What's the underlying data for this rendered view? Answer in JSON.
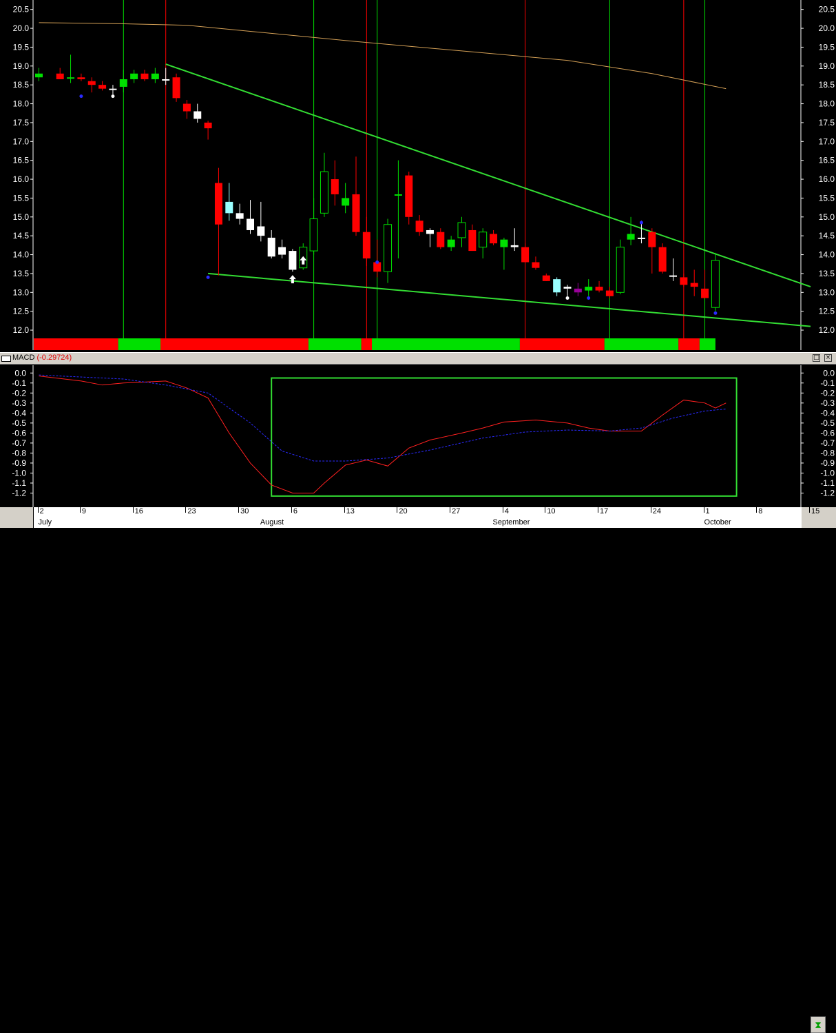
{
  "colors": {
    "bull": "#00e000",
    "bear": "#ff0000",
    "neutral": "#ffffff",
    "cyan": "#99ffff",
    "purple": "#990099",
    "trendline": "#33dd33",
    "ma200": "#d4a056",
    "macd": "#ff2020",
    "signal": "#2a2aff",
    "axis_text": "#ffffff"
  },
  "chart_data": [
    {
      "type": "candlestick",
      "ylim": [
        11.8,
        20.75
      ],
      "yticks": [
        "20.5",
        "20.0",
        "19.5",
        "19.0",
        "18.5",
        "18.0",
        "17.5",
        "17.0",
        "16.5",
        "16.0",
        "15.5",
        "15.0",
        "14.5",
        "14.0",
        "13.5",
        "13.0",
        "12.5",
        "12.0"
      ],
      "x_range": [
        0,
        98
      ],
      "candles": [
        {
          "x": 0,
          "o": 18.7,
          "h": 18.95,
          "l": 18.6,
          "c": 18.8,
          "col": "bull"
        },
        {
          "x": 2,
          "o": 18.8,
          "h": 18.95,
          "l": 18.65,
          "c": 18.65,
          "col": "bear"
        },
        {
          "x": 3,
          "o": 18.7,
          "h": 19.3,
          "l": 18.55,
          "c": 18.7,
          "col": "bull"
        },
        {
          "x": 4,
          "o": 18.7,
          "h": 18.8,
          "l": 18.6,
          "c": 18.65,
          "col": "bear"
        },
        {
          "x": 5,
          "o": 18.6,
          "h": 18.7,
          "l": 18.3,
          "c": 18.5,
          "col": "bear"
        },
        {
          "x": 6,
          "o": 18.5,
          "h": 18.6,
          "l": 18.35,
          "c": 18.4,
          "col": "bear"
        },
        {
          "x": 7,
          "o": 18.4,
          "h": 18.5,
          "l": 18.25,
          "c": 18.4,
          "col": "neutral"
        },
        {
          "x": 8,
          "o": 18.45,
          "h": 18.9,
          "l": 18.3,
          "c": 18.65,
          "col": "bull"
        },
        {
          "x": 9,
          "o": 18.65,
          "h": 18.9,
          "l": 18.55,
          "c": 18.8,
          "col": "bull"
        },
        {
          "x": 10,
          "o": 18.8,
          "h": 18.9,
          "l": 18.6,
          "c": 18.65,
          "col": "bear"
        },
        {
          "x": 11,
          "o": 18.65,
          "h": 18.95,
          "l": 18.55,
          "c": 18.8,
          "col": "bull"
        },
        {
          "x": 12,
          "o": 18.65,
          "h": 18.95,
          "l": 18.5,
          "c": 18.65,
          "col": "neutral"
        },
        {
          "x": 13,
          "o": 18.7,
          "h": 18.8,
          "l": 18.05,
          "c": 18.15,
          "col": "bear"
        },
        {
          "x": 14,
          "o": 18.0,
          "h": 18.1,
          "l": 17.6,
          "c": 17.8,
          "col": "bear"
        },
        {
          "x": 15,
          "o": 17.8,
          "h": 18.0,
          "l": 17.5,
          "c": 17.6,
          "col": "neutral"
        },
        {
          "x": 16,
          "o": 17.5,
          "h": 17.55,
          "l": 17.05,
          "c": 17.35,
          "col": "bear"
        },
        {
          "x": 17,
          "o": 15.9,
          "h": 16.3,
          "l": 13.45,
          "c": 14.8,
          "col": "bear"
        },
        {
          "x": 18,
          "o": 15.1,
          "h": 15.9,
          "l": 14.9,
          "c": 15.4,
          "col": "cyan"
        },
        {
          "x": 19,
          "o": 15.1,
          "h": 15.35,
          "l": 14.8,
          "c": 14.95,
          "col": "neutral"
        },
        {
          "x": 20,
          "o": 14.95,
          "h": 15.45,
          "l": 14.55,
          "c": 14.65,
          "col": "neutral"
        },
        {
          "x": 21,
          "o": 14.75,
          "h": 15.4,
          "l": 14.35,
          "c": 14.5,
          "col": "neutral"
        },
        {
          "x": 22,
          "o": 14.45,
          "h": 14.65,
          "l": 13.9,
          "c": 13.95,
          "col": "neutral"
        },
        {
          "x": 23,
          "o": 14.2,
          "h": 14.4,
          "l": 13.9,
          "c": 14.0,
          "col": "neutral"
        },
        {
          "x": 24,
          "o": 14.1,
          "h": 14.15,
          "l": 13.55,
          "c": 13.6,
          "col": "neutral"
        },
        {
          "x": 25,
          "o": 13.65,
          "h": 14.3,
          "l": 13.6,
          "c": 14.2,
          "col": "bull"
        },
        {
          "x": 26,
          "o": 14.1,
          "h": 15.5,
          "l": 14.0,
          "c": 14.95,
          "col": "bull"
        },
        {
          "x": 27,
          "o": 15.1,
          "h": 16.7,
          "l": 15.0,
          "c": 16.2,
          "col": "bull"
        },
        {
          "x": 28,
          "o": 16.0,
          "h": 16.5,
          "l": 15.3,
          "c": 15.6,
          "col": "bear"
        },
        {
          "x": 29,
          "o": 15.5,
          "h": 15.9,
          "l": 15.1,
          "c": 15.3,
          "col": "bull"
        },
        {
          "x": 30,
          "o": 15.6,
          "h": 16.6,
          "l": 14.5,
          "c": 14.6,
          "col": "bear"
        },
        {
          "x": 31,
          "o": 14.6,
          "h": 15.0,
          "l": 13.7,
          "c": 13.9,
          "col": "bear"
        },
        {
          "x": 32,
          "o": 13.8,
          "h": 14.4,
          "l": 13.4,
          "c": 13.55,
          "col": "bear"
        },
        {
          "x": 33,
          "o": 13.55,
          "h": 14.95,
          "l": 13.25,
          "c": 14.8,
          "col": "bull"
        },
        {
          "x": 34,
          "o": 15.6,
          "h": 16.5,
          "l": 13.9,
          "c": 15.6,
          "col": "bull"
        },
        {
          "x": 35,
          "o": 16.1,
          "h": 16.2,
          "l": 14.8,
          "c": 15.0,
          "col": "bear"
        },
        {
          "x": 36,
          "o": 14.9,
          "h": 15.05,
          "l": 14.5,
          "c": 14.6,
          "col": "bear"
        },
        {
          "x": 37,
          "o": 14.65,
          "h": 14.7,
          "l": 14.2,
          "c": 14.55,
          "col": "neutral"
        },
        {
          "x": 38,
          "o": 14.6,
          "h": 14.7,
          "l": 14.15,
          "c": 14.2,
          "col": "bear"
        },
        {
          "x": 39,
          "o": 14.2,
          "h": 14.5,
          "l": 14.1,
          "c": 14.4,
          "col": "bull"
        },
        {
          "x": 40,
          "o": 14.45,
          "h": 15.0,
          "l": 14.2,
          "c": 14.85,
          "col": "bull"
        },
        {
          "x": 41,
          "o": 14.65,
          "h": 14.8,
          "l": 14.1,
          "c": 14.1,
          "col": "bear"
        },
        {
          "x": 42,
          "o": 14.2,
          "h": 14.7,
          "l": 13.9,
          "c": 14.6,
          "col": "bull"
        },
        {
          "x": 43,
          "o": 14.55,
          "h": 14.65,
          "l": 14.25,
          "c": 14.3,
          "col": "bear"
        },
        {
          "x": 44,
          "o": 14.4,
          "h": 14.45,
          "l": 13.6,
          "c": 14.2,
          "col": "bull"
        },
        {
          "x": 45,
          "o": 14.2,
          "h": 14.7,
          "l": 14.1,
          "c": 14.25,
          "col": "neutral"
        },
        {
          "x": 46,
          "o": 14.2,
          "h": 14.3,
          "l": 13.8,
          "c": 13.8,
          "col": "bear"
        },
        {
          "x": 47,
          "o": 13.8,
          "h": 13.95,
          "l": 13.6,
          "c": 13.65,
          "col": "bear"
        },
        {
          "x": 48,
          "o": 13.45,
          "h": 13.5,
          "l": 13.3,
          "c": 13.3,
          "col": "bear"
        },
        {
          "x": 49,
          "o": 13.0,
          "h": 13.4,
          "l": 12.9,
          "c": 13.35,
          "col": "cyan"
        },
        {
          "x": 50,
          "o": 13.15,
          "h": 13.2,
          "l": 12.9,
          "c": 13.1,
          "col": "neutral"
        },
        {
          "x": 51,
          "o": 13.1,
          "h": 13.25,
          "l": 12.9,
          "c": 13.0,
          "col": "purple"
        },
        {
          "x": 52,
          "o": 13.05,
          "h": 13.35,
          "l": 12.9,
          "c": 13.15,
          "col": "bull"
        },
        {
          "x": 53,
          "o": 13.15,
          "h": 13.3,
          "l": 13.0,
          "c": 13.05,
          "col": "bear"
        },
        {
          "x": 54,
          "o": 13.05,
          "h": 13.15,
          "l": 12.85,
          "c": 12.9,
          "col": "bear"
        },
        {
          "x": 55,
          "o": 13.0,
          "h": 14.4,
          "l": 12.95,
          "c": 14.2,
          "col": "bull"
        },
        {
          "x": 56,
          "o": 14.4,
          "h": 15.0,
          "l": 14.25,
          "c": 14.55,
          "col": "bull"
        },
        {
          "x": 57,
          "o": 14.45,
          "h": 14.9,
          "l": 14.3,
          "c": 14.45,
          "col": "neutral"
        },
        {
          "x": 58,
          "o": 14.6,
          "h": 14.7,
          "l": 13.5,
          "c": 14.2,
          "col": "bear"
        },
        {
          "x": 59,
          "o": 14.2,
          "h": 14.3,
          "l": 13.5,
          "c": 13.55,
          "col": "bear"
        },
        {
          "x": 60,
          "o": 13.45,
          "h": 13.9,
          "l": 13.3,
          "c": 13.45,
          "col": "neutral"
        },
        {
          "x": 61,
          "o": 13.4,
          "h": 13.5,
          "l": 13.15,
          "c": 13.2,
          "col": "bear"
        },
        {
          "x": 62,
          "o": 13.25,
          "h": 13.6,
          "l": 12.9,
          "c": 13.15,
          "col": "bear"
        },
        {
          "x": 63,
          "o": 13.1,
          "h": 13.6,
          "l": 12.85,
          "c": 12.85,
          "col": "bear"
        },
        {
          "x": 64,
          "o": 12.6,
          "h": 14.05,
          "l": 12.5,
          "c": 13.85,
          "col": "bull"
        }
      ],
      "ma200": [
        [
          0,
          20.15
        ],
        [
          8,
          20.12
        ],
        [
          14,
          20.08
        ],
        [
          20,
          19.92
        ],
        [
          30,
          19.65
        ],
        [
          40,
          19.4
        ],
        [
          50,
          19.15
        ],
        [
          58,
          18.8
        ],
        [
          65,
          18.4
        ]
      ],
      "trendlines": [
        {
          "x1": 12,
          "y1": 19.05,
          "x2": 73,
          "y2": 13.15
        },
        {
          "x1": 16,
          "y1": 13.5,
          "x2": 73,
          "y2": 12.1
        }
      ],
      "vlines": [
        {
          "x": 8,
          "col": "bull"
        },
        {
          "x": 12,
          "col": "bear"
        },
        {
          "x": 26,
          "col": "bull"
        },
        {
          "x": 31,
          "col": "bear"
        },
        {
          "x": 32,
          "col": "bull"
        },
        {
          "x": 46,
          "col": "bear"
        },
        {
          "x": 54,
          "col": "bull"
        },
        {
          "x": 61,
          "col": "bear"
        },
        {
          "x": 63,
          "col": "bull"
        }
      ],
      "dots": [
        {
          "x": 4,
          "y": 18.2,
          "col": "signal"
        },
        {
          "x": 7,
          "y": 18.2,
          "col": "neutral"
        },
        {
          "x": 16,
          "y": 13.4,
          "col": "signal"
        },
        {
          "x": 32,
          "y": 13.8,
          "col": "signal"
        },
        {
          "x": 50,
          "y": 12.85,
          "col": "neutral"
        },
        {
          "x": 52,
          "y": 12.85,
          "col": "signal"
        },
        {
          "x": 57,
          "y": 14.85,
          "col": "signal"
        },
        {
          "x": 64,
          "y": 12.45,
          "col": "signal"
        }
      ],
      "arrows": [
        {
          "x": 24,
          "y": 13.35
        },
        {
          "x": 25,
          "y": 13.85
        }
      ],
      "regimes": [
        {
          "from": -0.5,
          "to": 7.5,
          "col": "bear"
        },
        {
          "from": 7.5,
          "to": 11.5,
          "col": "bull"
        },
        {
          "from": 11.5,
          "to": 25.5,
          "col": "bear"
        },
        {
          "from": 25.5,
          "to": 30.5,
          "col": "bull"
        },
        {
          "from": 30.5,
          "to": 31.5,
          "col": "bear"
        },
        {
          "from": 31.5,
          "to": 45.5,
          "col": "bull"
        },
        {
          "from": 45.5,
          "to": 53.5,
          "col": "bear"
        },
        {
          "from": 53.5,
          "to": 60.5,
          "col": "bull"
        },
        {
          "from": 60.5,
          "to": 62.5,
          "col": "bear"
        },
        {
          "from": 62.5,
          "to": 64,
          "col": "bull"
        }
      ]
    },
    {
      "type": "line",
      "title": "MACD",
      "last_value": "(-0.29724)",
      "ylim": [
        -1.3,
        0.05
      ],
      "yticks": [
        "0.0",
        "-0.1",
        "-0.2",
        "-0.3",
        "-0.4",
        "-0.5",
        "-0.6",
        "-0.7",
        "-0.8",
        "-0.9",
        "-1.0",
        "-1.1",
        "-1.2"
      ],
      "series": [
        {
          "role": "macd",
          "values": [
            [
              0,
              -0.03
            ],
            [
              4,
              -0.08
            ],
            [
              6,
              -0.12
            ],
            [
              8,
              -0.1
            ],
            [
              10,
              -0.09
            ],
            [
              12,
              -0.08
            ],
            [
              14,
              -0.15
            ],
            [
              16,
              -0.25
            ],
            [
              18,
              -0.6
            ],
            [
              20,
              -0.9
            ],
            [
              22,
              -1.12
            ],
            [
              24,
              -1.2
            ],
            [
              26,
              -1.2
            ],
            [
              27,
              -1.1
            ],
            [
              29,
              -0.92
            ],
            [
              31,
              -0.87
            ],
            [
              33,
              -0.93
            ],
            [
              35,
              -0.75
            ],
            [
              37,
              -0.67
            ],
            [
              40,
              -0.6
            ],
            [
              42,
              -0.55
            ],
            [
              44,
              -0.49
            ],
            [
              47,
              -0.47
            ],
            [
              50,
              -0.5
            ],
            [
              52,
              -0.55
            ],
            [
              54,
              -0.58
            ],
            [
              57,
              -0.58
            ],
            [
              59,
              -0.42
            ],
            [
              61,
              -0.27
            ],
            [
              63,
              -0.3
            ],
            [
              64,
              -0.35
            ],
            [
              65,
              -0.3
            ]
          ]
        },
        {
          "role": "signal",
          "values": [
            [
              0,
              -0.02
            ],
            [
              8,
              -0.06
            ],
            [
              12,
              -0.12
            ],
            [
              16,
              -0.2
            ],
            [
              20,
              -0.5
            ],
            [
              23,
              -0.78
            ],
            [
              26,
              -0.88
            ],
            [
              29,
              -0.88
            ],
            [
              33,
              -0.85
            ],
            [
              37,
              -0.77
            ],
            [
              42,
              -0.65
            ],
            [
              46,
              -0.59
            ],
            [
              50,
              -0.57
            ],
            [
              54,
              -0.58
            ],
            [
              57,
              -0.55
            ],
            [
              60,
              -0.45
            ],
            [
              63,
              -0.38
            ],
            [
              65,
              -0.36
            ]
          ]
        }
      ],
      "box": {
        "x1": 22,
        "x2": 66,
        "y1": -0.05,
        "y2": -1.23
      }
    }
  ],
  "time_axis": {
    "days": [
      {
        "x": 0,
        "label": "2"
      },
      {
        "x": 4,
        "label": "9"
      },
      {
        "x": 9,
        "label": "16"
      },
      {
        "x": 14,
        "label": "23"
      },
      {
        "x": 19,
        "label": "30"
      },
      {
        "x": 24,
        "label": "6"
      },
      {
        "x": 29,
        "label": "13"
      },
      {
        "x": 34,
        "label": "20"
      },
      {
        "x": 39,
        "label": "27"
      },
      {
        "x": 44,
        "label": "4"
      },
      {
        "x": 48,
        "label": "10"
      },
      {
        "x": 53,
        "label": "17"
      },
      {
        "x": 58,
        "label": "24"
      },
      {
        "x": 63,
        "label": "1"
      },
      {
        "x": 68,
        "label": "8"
      },
      {
        "x": 73,
        "label": "15"
      }
    ],
    "months": [
      {
        "x": 0,
        "label": "July"
      },
      {
        "x": 21,
        "label": "August"
      },
      {
        "x": 43,
        "label": "September"
      },
      {
        "x": 63,
        "label": "October"
      }
    ]
  },
  "panel": {
    "indicator": "MACD",
    "value": "(-0.29724)"
  }
}
